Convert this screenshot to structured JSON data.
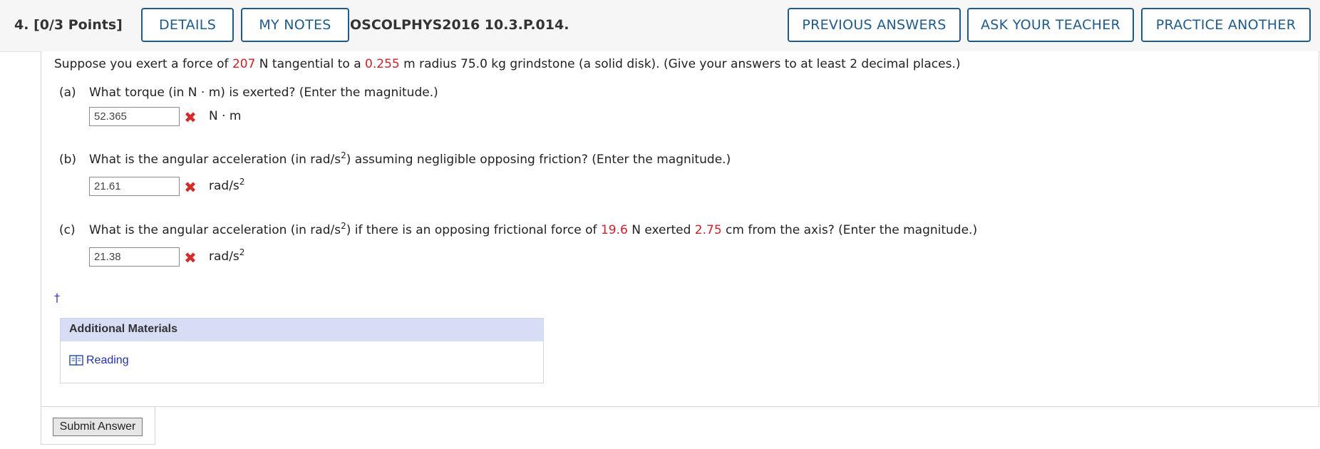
{
  "header": {
    "question_number": "4.",
    "points": "[0/3 Points]",
    "details_label": "DETAILS",
    "notes_label": "MY NOTES",
    "question_id": "OSCOLPHYS2016 10.3.P.014.",
    "previous_answers_label": "PREVIOUS ANSWERS",
    "ask_teacher_label": "ASK YOUR TEACHER",
    "practice_label": "PRACTICE ANOTHER"
  },
  "intro": {
    "t1": "Suppose you exert a force of ",
    "force": "207",
    "t2": " N tangential to a ",
    "radius": "0.255",
    "t3": " m radius 75.0 kg grindstone (a solid disk). (Give your answers to at least 2 decimal places.)"
  },
  "parts": {
    "a": {
      "letter": "(a)",
      "question": "What torque (in N · m) is exerted? (Enter the magnitude.)",
      "answer": "52.365",
      "unit": "N · m"
    },
    "b": {
      "letter": "(b)",
      "q1": "What is the angular acceleration (in rad/s",
      "q_sup": "2",
      "q2": ") assuming negligible opposing friction? (Enter the magnitude.)",
      "answer": "21.61",
      "unit": "rad/s",
      "unit_sup": "2"
    },
    "c": {
      "letter": "(c)",
      "q1": "What is the angular acceleration (in rad/s",
      "q_sup": "2",
      "q2": ") if there is an opposing frictional force of ",
      "friction": "19.6",
      "q3": " N exerted ",
      "distance": "2.75",
      "q4": " cm from the axis? (Enter the magnitude.)",
      "answer": "21.38",
      "unit": "rad/s",
      "unit_sup": "2"
    }
  },
  "dagger": "†",
  "additional_materials": {
    "title": "Additional Materials",
    "reading_label": "Reading"
  },
  "submit_label": "Submit Answer",
  "colors": {
    "accent": "#1f5a8c",
    "highlight_red": "#d0202a",
    "materials_header": "#d8ddf6"
  },
  "icons": {
    "incorrect": "x-mark-icon",
    "reading": "book-icon"
  }
}
